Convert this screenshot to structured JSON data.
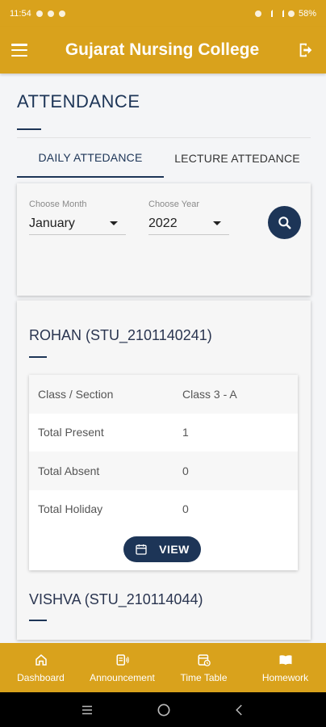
{
  "status_bar": {
    "time": "11:54",
    "battery": "58%"
  },
  "app_bar": {
    "title": "Gujarat Nursing College"
  },
  "page": {
    "heading": "ATTENDANCE"
  },
  "tabs": [
    {
      "label": "DAILY ATTEDANCE",
      "active": true
    },
    {
      "label": "LECTURE ATTEDANCE",
      "active": false
    }
  ],
  "filters": {
    "month": {
      "label": "Choose Month",
      "value": "January"
    },
    "year": {
      "label": "Choose Year",
      "value": "2022"
    }
  },
  "students": [
    {
      "name": "ROHAN (STU_2101140241)",
      "rows": [
        {
          "label": "Class / Section",
          "value": "Class 3 - A"
        },
        {
          "label": "Total Present",
          "value": "1"
        },
        {
          "label": "Total Absent",
          "value": "0"
        },
        {
          "label": "Total Holiday",
          "value": "0"
        }
      ],
      "view_label": "VIEW"
    },
    {
      "name": "VISHVA (STU_210114044)"
    }
  ],
  "bottom_nav": [
    {
      "label": "Dashboard",
      "icon": "home-icon"
    },
    {
      "label": "Announcement",
      "icon": "announcement-icon"
    },
    {
      "label": "Time Table",
      "icon": "timetable-icon"
    },
    {
      "label": "Homework",
      "icon": "book-icon"
    }
  ],
  "colors": {
    "primary": "#d9a21c",
    "accent": "#1d3557"
  }
}
